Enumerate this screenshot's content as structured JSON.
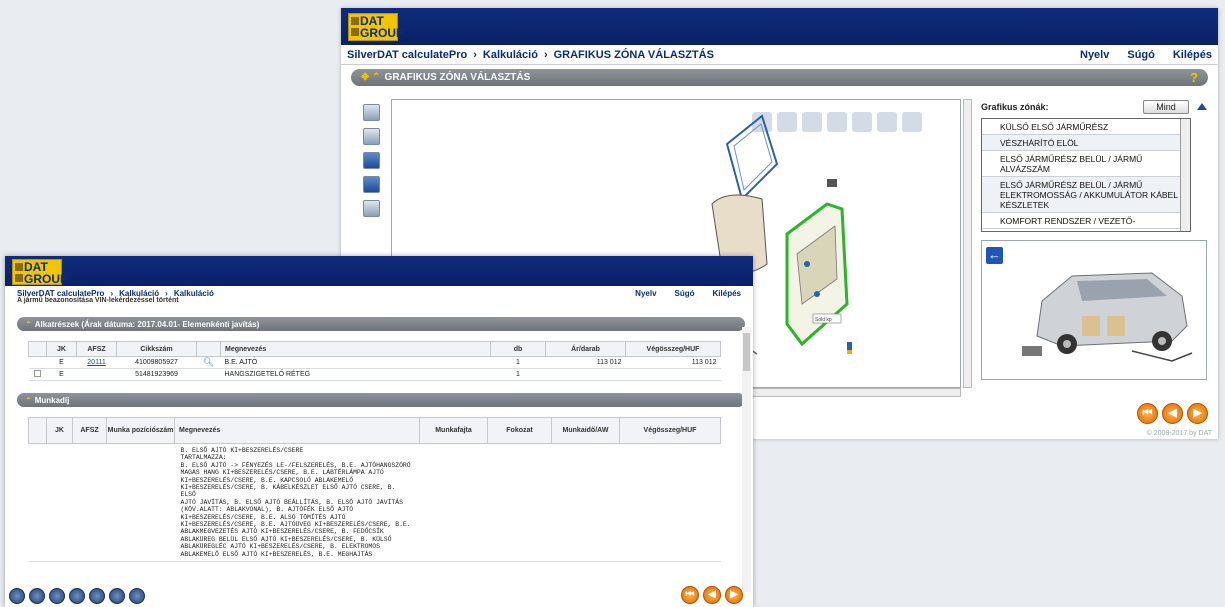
{
  "back_window": {
    "logo_top": "DAT",
    "logo_bottom": "GROUP",
    "breadcrumb": [
      "SilverDAT calculatePro",
      "Kalkuláció",
      "GRAFIKUS ZÓNA VÁLASZTÁS"
    ],
    "nav_links": [
      "Nyelv",
      "Súgó",
      "Kilépés"
    ],
    "section_title": "GRAFIKUS ZÓNA VÁLASZTÁS",
    "help_icon": "?",
    "diagram_label": "Sold kp",
    "zones_label": "Grafikus zónák:",
    "mind_button": "Mind",
    "zones": [
      "KÜLSŐ ELSŐ JÁRMŰRÉSZ",
      "VÉSZHÁRÍTÓ ELÖL",
      "ELSŐ JÁRMŰRÉSZ BELÜL / JÁRMŰ ALVÁZSZÁM",
      "ELSŐ JÁRMŰRÉSZ BELÜL / JÁRMŰ ELEKTROMOSSÁG / AKKUMULÁTOR KÁBEL KÉSZLETEK",
      "KOMFORT RENDSZER / VEZETŐ-"
    ],
    "copyright": "© 2008-2017 by DAT"
  },
  "front_window": {
    "logo_top": "DAT",
    "logo_bottom": "GROUP",
    "breadcrumb": [
      "SilverDAT calculatePro",
      "Kalkuláció",
      "Kalkuláció"
    ],
    "nav_links": [
      "Nyelv",
      "Súgó",
      "Kilépés"
    ],
    "notice": "A jármű beazonosítása VIN-lekérdezéssel történt",
    "parts_section": "Alkatrészek (Árak dátuma: 2017.04.01- Elemenkénti javítás)",
    "parts_headers": [
      "JK",
      "AFSZ",
      "Cikkszám",
      "",
      "Megnevezés",
      "db",
      "Ár/darab",
      "Végösszeg/HUF"
    ],
    "parts_rows": [
      {
        "jk": "E",
        "afsz": "20111",
        "cikkszam": "41009805927",
        "megnevezes": "B.E. AJTÓ",
        "db": "1",
        "ar": "113 012",
        "vegosszeg": "113 012"
      },
      {
        "jk": "E",
        "afsz": "",
        "cikkszam": "51481923969",
        "megnevezes": "HANGSZIGETELŐ RÉTEG",
        "db": "1",
        "ar": "",
        "vegosszeg": ""
      }
    ],
    "labor_section": "Munkadíj",
    "labor_headers": [
      "JK",
      "AFSZ",
      "Munka pozíciószám",
      "Megnevezés",
      "Munkafajta",
      "Fokozat",
      "Munkaidő/AW",
      "Végösszeg/HUF"
    ],
    "labor_description": "B. ELSŐ AJTÓ KI+BESZERELÉS/CSERE\nTARTALMAZZA:\nB. ELSŐ AJTÓ -> FÉNYEZÉS LE-/FELSZERELÉS, B.E. AJTÓHANGSZÓRÓ\nMAGAS HANG KI+BESZERELÉS/CSERE, B.E. LÁBTÉRLÁMPA AJTÓ\nKI+BESZERELÉS/CSERE, B.E. KAPCSOLÓ ABLAKEMELŐ\nKI+BESZERELÉS/CSERE, B. KÁBELKÉSZLET ELSŐ AJTÓ CSERE, B. ELSŐ\nAJTÓ JAVÍTÁS, B. ELSŐ AJTÓ BEÁLLÍTÁS, B. ELSŐ AJTÓ JAVÍTÁS\n(KÖV.ALATT: ABLAKVONAL), B. AJTÓFÉK ELSŐ AJTÓ\nKI+BESZERELÉS/CSERE, B.E. ALSÓ TÖMÍTÉS AJTÓ\nKI+BESZERELÉS/CSERE, B.E. AJTÓÜVEG KI+BESZERELÉS/CSERE, B.E.\nABLAKMEGVEZETÉS AJTÓ KI+BESZERELÉS/CSERE, B. FEDŐCSÍK\nABLAKÜREG BELÜL ELSŐ AJTÓ KI+BESZERELÉS/CSERE, B. KÜLSŐ\nABLAKÜREGLÉC AJTÓ KI+BESZERELÉS/CSERE, B. ELEKTROMOS\nABLAKEMELŐ ELSŐ AJTÓ KI+BESZERELÉS, B.E. MEGHAJTÁS"
  },
  "colors": {
    "header_blue": "#0f2c7c",
    "nav_text": "#0b2a7c",
    "logo_yellow": "#f1c500",
    "accent_orange": "#e06b00"
  },
  "icons": [
    "search-icon",
    "back-arrow-icon",
    "forward-arrow-icon",
    "first-page-icon",
    "help-icon",
    "expand-chevron-icon"
  ]
}
